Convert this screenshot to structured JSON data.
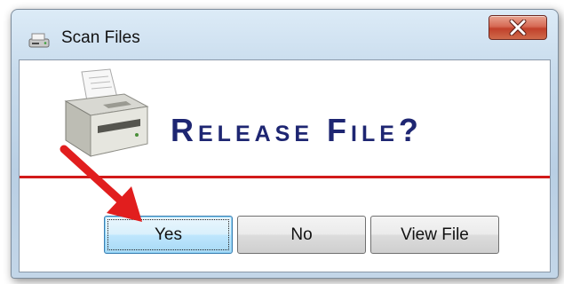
{
  "window": {
    "title": "Scan Files",
    "title_icon": "scanner-icon",
    "close_icon": "close-icon"
  },
  "dialog": {
    "printer_icon": "printer-icon",
    "message": "Release File?",
    "divider_color": "#d21a1a",
    "message_color": "#1e2672"
  },
  "buttons": {
    "yes_label": "Yes",
    "no_label": "No",
    "view_label": "View File"
  },
  "annotation": {
    "arrow_icon": "red-arrow-icon",
    "arrow_color": "#e11e1e"
  }
}
